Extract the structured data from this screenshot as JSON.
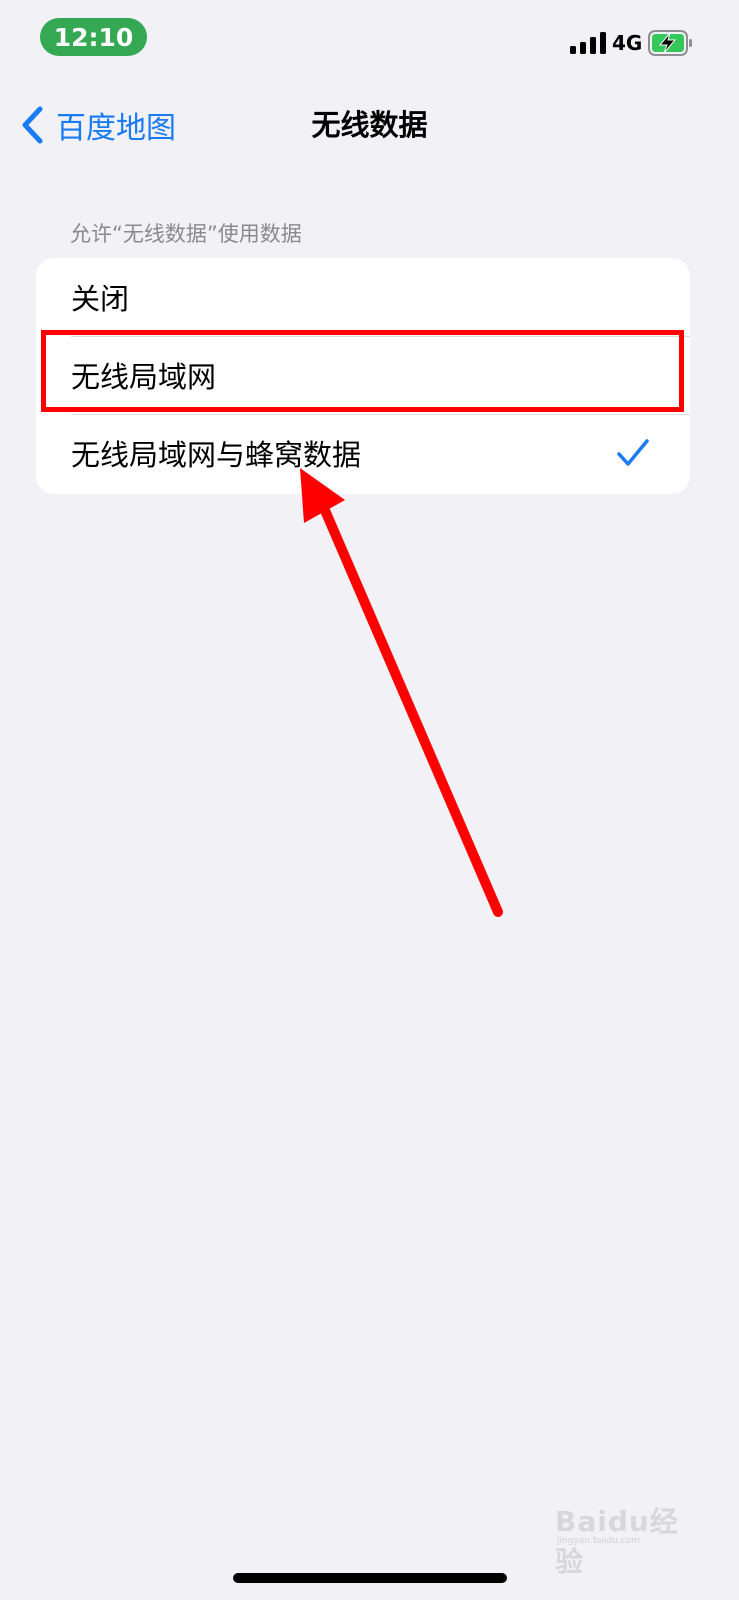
{
  "status_bar": {
    "time": "12:10",
    "network": "4G",
    "signal_icon": "cellular-signal-icon",
    "battery_icon": "battery-charging-icon",
    "time_pill_color": "#34a853"
  },
  "nav": {
    "back_label": "百度地图",
    "back_icon": "chevron-left-icon",
    "title": "无线数据",
    "accent_color": "#1a7cf5"
  },
  "section": {
    "header": "允许“无线数据”使用数据",
    "options": [
      {
        "label": "关闭",
        "selected": false
      },
      {
        "label": "无线局域网",
        "selected": false
      },
      {
        "label": "无线局域网与蜂窝数据",
        "selected": true
      }
    ]
  },
  "annotation": {
    "highlight_color": "#ff0000",
    "highlighted_option": "无线局域网"
  },
  "watermark": {
    "text": "Baidu经验",
    "subtext": "jingyan.baidu.com"
  }
}
